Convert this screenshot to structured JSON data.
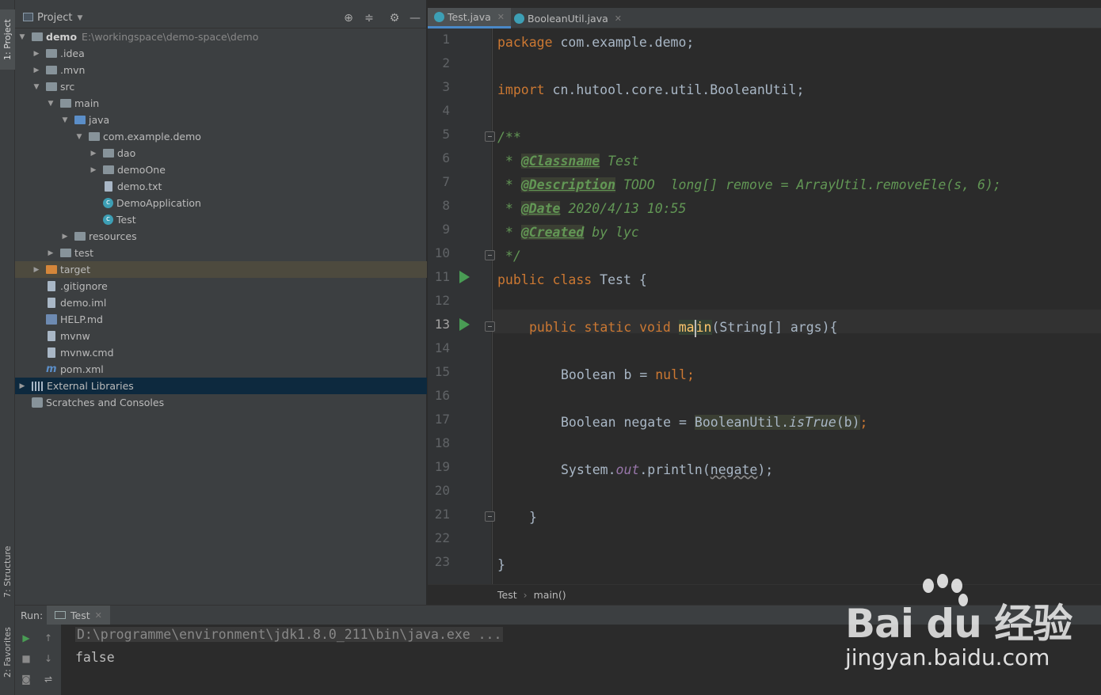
{
  "left_stripe": {
    "project_tab": "1: Project",
    "structure_tab": "7: Structure",
    "favorites_tab": "2: Favorites"
  },
  "project_panel": {
    "title": "Project",
    "tree": [
      {
        "label": "demo",
        "path": "E:\\workingspace\\demo-space\\demo"
      },
      {
        "label": ".idea"
      },
      {
        "label": ".mvn"
      },
      {
        "label": "src"
      },
      {
        "label": "main"
      },
      {
        "label": "java"
      },
      {
        "label": "com.example.demo"
      },
      {
        "label": "dao"
      },
      {
        "label": "demoOne"
      },
      {
        "label": "demo.txt"
      },
      {
        "label": "DemoApplication"
      },
      {
        "label": "Test"
      },
      {
        "label": "resources"
      },
      {
        "label": "test"
      },
      {
        "label": "target"
      },
      {
        "label": ".gitignore"
      },
      {
        "label": "demo.iml"
      },
      {
        "label": "HELP.md"
      },
      {
        "label": "mvnw"
      },
      {
        "label": "mvnw.cmd"
      },
      {
        "label": "pom.xml"
      },
      {
        "label": "External Libraries"
      },
      {
        "label": "Scratches and Consoles"
      }
    ]
  },
  "editor": {
    "tabs": [
      {
        "label": "Test.java",
        "active": true
      },
      {
        "label": "BooleanUtil.java",
        "active": false
      }
    ],
    "line_numbers": [
      "1",
      "2",
      "3",
      "4",
      "5",
      "6",
      "7",
      "8",
      "9",
      "10",
      "11",
      "12",
      "13",
      "14",
      "15",
      "16",
      "17",
      "18",
      "19",
      "20",
      "21",
      "22",
      "23"
    ],
    "current_line": 13,
    "code": {
      "l1_kw": "package",
      "l1_rest": " com.example.demo;",
      "l3_kw": "import",
      "l3_rest": " cn.hutool.core.util.BooleanUtil;",
      "l5": "/**",
      "l6_pre": " * ",
      "l6_tag": "@Classname",
      "l6_rest": " Test",
      "l7_pre": " * ",
      "l7_tag": "@Description",
      "l7_rest": " TODO  long[] remove = ArrayUtil.removeEle(s, 6);",
      "l8_pre": " * ",
      "l8_tag": "@Date",
      "l8_rest": " 2020/4/13 10:55",
      "l9_pre": " * ",
      "l9_tag": "@Created",
      "l9_rest": " by lyc",
      "l10": " */",
      "l11_kw": "public class",
      "l11_rest": " Test {",
      "l13_kw": "public static void",
      "l13_m1": "ma",
      "l13_m2": "in",
      "l13_rest": "(String[] args){",
      "l15_a": "Boolean b = ",
      "l15_kw": "null",
      "l15_semi": ";",
      "l17_a": "Boolean negate = ",
      "l17_b": "BooleanUtil.",
      "l17_m": "isTrue",
      "l17_c": "(b)",
      "l17_semi": ";",
      "l19_a": "System.",
      "l19_out": "out",
      "l19_b": ".println(",
      "l19_arg": "negate",
      "l19_c": ");",
      "l21": "}",
      "l23": "}"
    },
    "breadcrumbs": [
      "Test",
      "main()"
    ]
  },
  "run_panel": {
    "label": "Run:",
    "tab": "Test",
    "console": [
      "D:\\programme\\environment\\jdk1.8.0_211\\bin\\java.exe ...",
      "false"
    ]
  },
  "watermark": {
    "logo": "Bai du 经验",
    "url": "jingyan.baidu.com"
  },
  "colors": {
    "keyword": "#cc7832",
    "doc_comment": "#629755",
    "static_field": "#9876aa",
    "run_green": "#499c54",
    "selection_blue": "#0d293e"
  }
}
